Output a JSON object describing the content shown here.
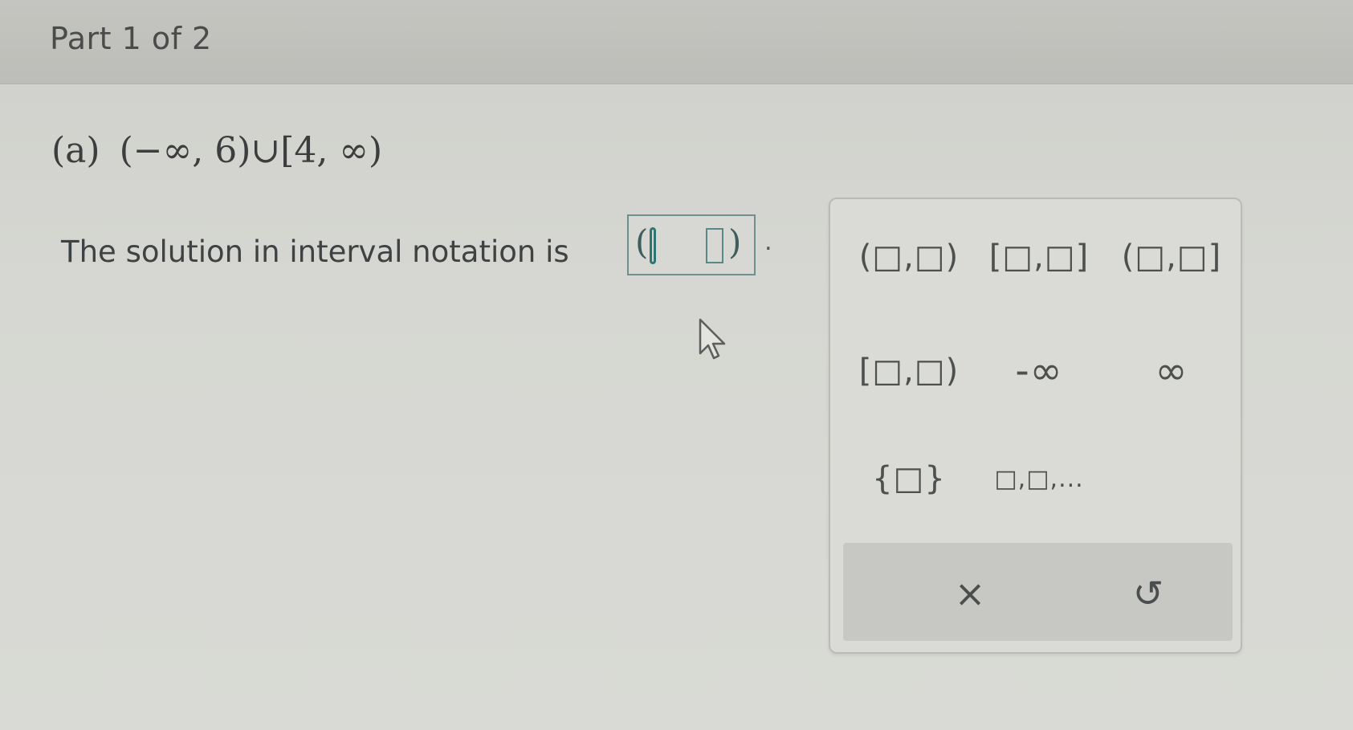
{
  "header": {
    "part_label": "Part 1 of 2"
  },
  "question": {
    "label": "(a)",
    "expression": "(−∞, 6)∪[4, ∞)"
  },
  "prompt": {
    "text": "The solution in interval notation is"
  },
  "answer": {
    "period": "."
  },
  "palette": {
    "buttons": [
      "(□,□)",
      "[□,□]",
      "(□,□]",
      "[□,□)",
      "-∞",
      "∞",
      "{□}",
      "□,□,..."
    ],
    "clear_label": "×",
    "undo_label": "↺"
  }
}
